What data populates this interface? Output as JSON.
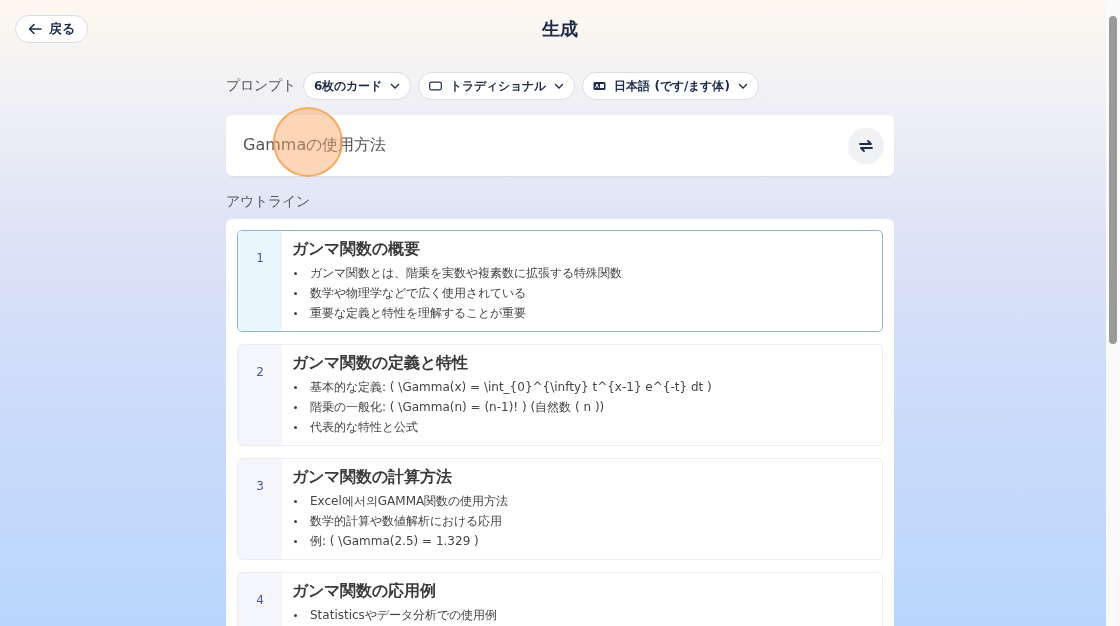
{
  "header": {
    "back_button": "戻る",
    "title": "生成"
  },
  "prompt": {
    "label": "プロンプト",
    "options": [
      {
        "kind": "count",
        "label": "6枚のカード"
      },
      {
        "kind": "style",
        "label": "トラディショナル"
      },
      {
        "kind": "language",
        "label": "日本語 (です/ます体)"
      }
    ],
    "value": "Gammaの使用方法"
  },
  "outline": {
    "label": "アウトライン",
    "cards": [
      {
        "number": "1",
        "title": "ガンマ関数の概要",
        "selected": true,
        "bullets": [
          "ガンマ関数とは、階乗を実数や複素数に拡張する特殊関数",
          "数学や物理学などで広く使用されている",
          "重要な定義と特性を理解することが重要"
        ]
      },
      {
        "number": "2",
        "title": "ガンマ関数の定義と特性",
        "selected": false,
        "bullets": [
          "基本的な定義: ( \\Gamma(x) = \\int_{0}^{\\infty} t^{x-1} e^{-t} dt )",
          "階乗の一般化: ( \\Gamma(n) = (n-1)! ) (自然数 ( n ))",
          "代表的な特性と公式"
        ]
      },
      {
        "number": "3",
        "title": "ガンマ関数の計算方法",
        "selected": false,
        "bullets": [
          "Excel에서의GAMMA関数の使用方法",
          "数学的計算や数値解析における応用",
          "例: ( \\Gamma(2.5) = 1.329 )"
        ]
      },
      {
        "number": "4",
        "title": "ガンマ関数の応用例",
        "selected": false,
        "bullets": [
          "Statisticsやデータ分析での使用例"
        ]
      }
    ]
  }
}
